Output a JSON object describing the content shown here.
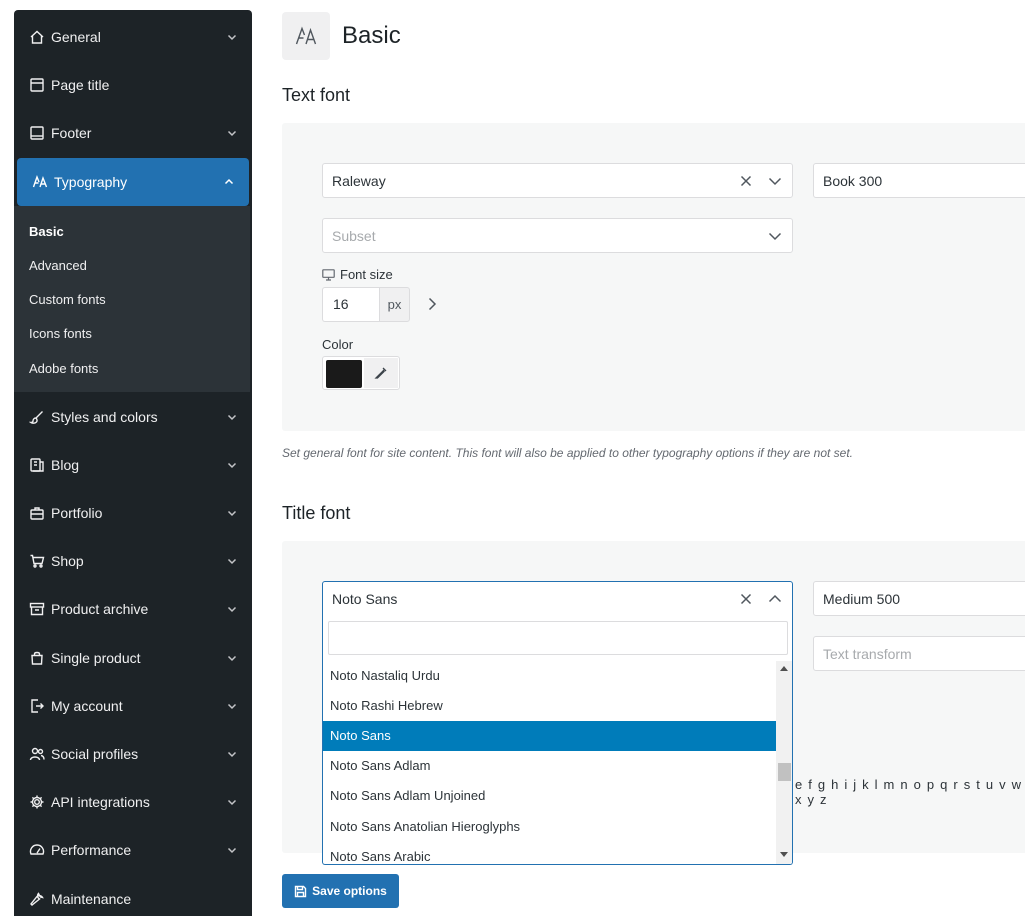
{
  "sidebar": {
    "items": [
      {
        "label": "General",
        "icon": "home-icon",
        "chevron": "chevron-down"
      },
      {
        "label": "Page title",
        "icon": "page-title-icon"
      },
      {
        "label": "Footer",
        "icon": "footer-icon",
        "chevron": "chevron-down"
      },
      {
        "label": "Typography",
        "icon": "typography-icon",
        "chevron": "chevron-up",
        "active": true
      },
      {
        "label": "Styles and colors",
        "icon": "brush-icon",
        "chevron": "chevron-down"
      },
      {
        "label": "Blog",
        "icon": "blog-icon",
        "chevron": "chevron-down"
      },
      {
        "label": "Portfolio",
        "icon": "briefcase-icon",
        "chevron": "chevron-down"
      },
      {
        "label": "Shop",
        "icon": "cart-icon",
        "chevron": "chevron-down"
      },
      {
        "label": "Product archive",
        "icon": "archive-icon",
        "chevron": "chevron-down"
      },
      {
        "label": "Single product",
        "icon": "bag-icon",
        "chevron": "chevron-down"
      },
      {
        "label": "My account",
        "icon": "account-icon",
        "chevron": "chevron-down"
      },
      {
        "label": "Social profiles",
        "icon": "people-icon",
        "chevron": "chevron-down"
      },
      {
        "label": "API integrations",
        "icon": "gear-icon",
        "chevron": "chevron-down"
      },
      {
        "label": "Performance",
        "icon": "gauge-icon",
        "chevron": "chevron-down"
      },
      {
        "label": "Maintenance",
        "icon": "wrench-icon"
      }
    ],
    "submenu": [
      "Basic",
      "Advanced",
      "Custom fonts",
      "Icons fonts",
      "Adobe fonts"
    ],
    "submenu_current": "Basic"
  },
  "header": {
    "title": "Basic",
    "icon": "typography-icon"
  },
  "text_font": {
    "title": "Text font",
    "family": "Raleway",
    "weight": "Book 300",
    "subset_placeholder": "Subset",
    "font_size_label": "Font size",
    "font_size_value": "16",
    "font_size_unit": "px",
    "color_label": "Color",
    "color_value": "#1a1a1a",
    "description": "Set general font for site content. This font will also be applied to other typography options if they are not set."
  },
  "title_font": {
    "title": "Title font",
    "family": "Noto Sans",
    "weight": "Medium 500",
    "text_transform_placeholder": "Text transform",
    "preview_alphabet": "e f g h i j k l m n o p q r s t u v w x y z"
  },
  "dropdown": {
    "search_value": "",
    "options": [
      "Noto Nastaliq Urdu",
      "Noto Rashi Hebrew",
      "Noto Sans",
      "Noto Sans Adlam",
      "Noto Sans Adlam Unjoined",
      "Noto Sans Anatolian Hieroglyphs",
      "Noto Sans Arabic"
    ],
    "selected": "Noto Sans"
  },
  "save_button": {
    "label": "Save options"
  },
  "colors": {
    "accent": "#2271b1",
    "selected_option": "#007cba",
    "sidebar_bg": "#1d2327"
  }
}
